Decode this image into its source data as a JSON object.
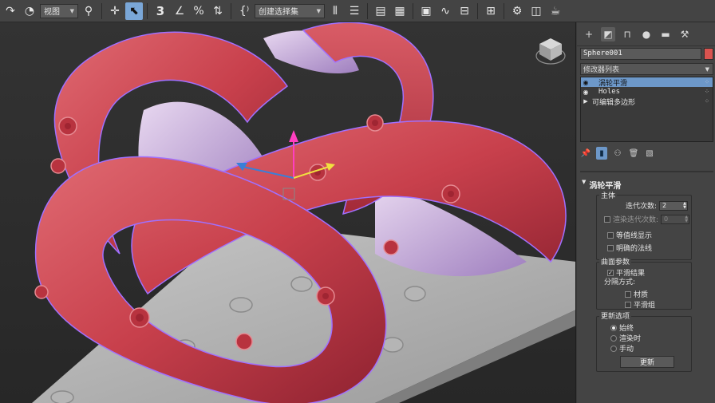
{
  "toolbar": {
    "view_dropdown": "视图",
    "selection_set_dropdown": "创建选择集",
    "snap_label": "3",
    "snap_sup": "n",
    "percent_label": "%"
  },
  "command_panel": {
    "tabs": [
      "create-icon",
      "modify-icon",
      "hierarchy-icon",
      "motion-icon",
      "display-icon",
      "utilities-icon"
    ],
    "object_name": "Sphere001",
    "object_color": "#d9534f",
    "modifier_list_label": "修改器列表",
    "stack": [
      {
        "label": "涡轮平滑",
        "selected": true
      },
      {
        "label": "Holes",
        "selected": false
      },
      {
        "label": "可编辑多边形",
        "selected": false
      }
    ]
  },
  "turbosmooth": {
    "title": "涡轮平滑",
    "main_group": "主体",
    "iterations_label": "迭代次数:",
    "iterations_value": "2",
    "render_iters_label": "渲染迭代次数:",
    "render_iters_value": "0",
    "isoline_label": "等值线显示",
    "explicit_normals_label": "明确的法线",
    "surface_group": "曲面参数",
    "smooth_result_label": "平滑结果",
    "separate_by_label": "分隔方式:",
    "materials_label": "材质",
    "smoothing_groups_label": "平滑组",
    "update_group": "更新选项",
    "always_label": "始终",
    "when_rendering_label": "渲染时",
    "manually_label": "手动",
    "update_button": "更新"
  },
  "colors": {
    "accent": "#6d98c9",
    "object_red": "#c8404c",
    "selection_outline": "#a070ff"
  }
}
